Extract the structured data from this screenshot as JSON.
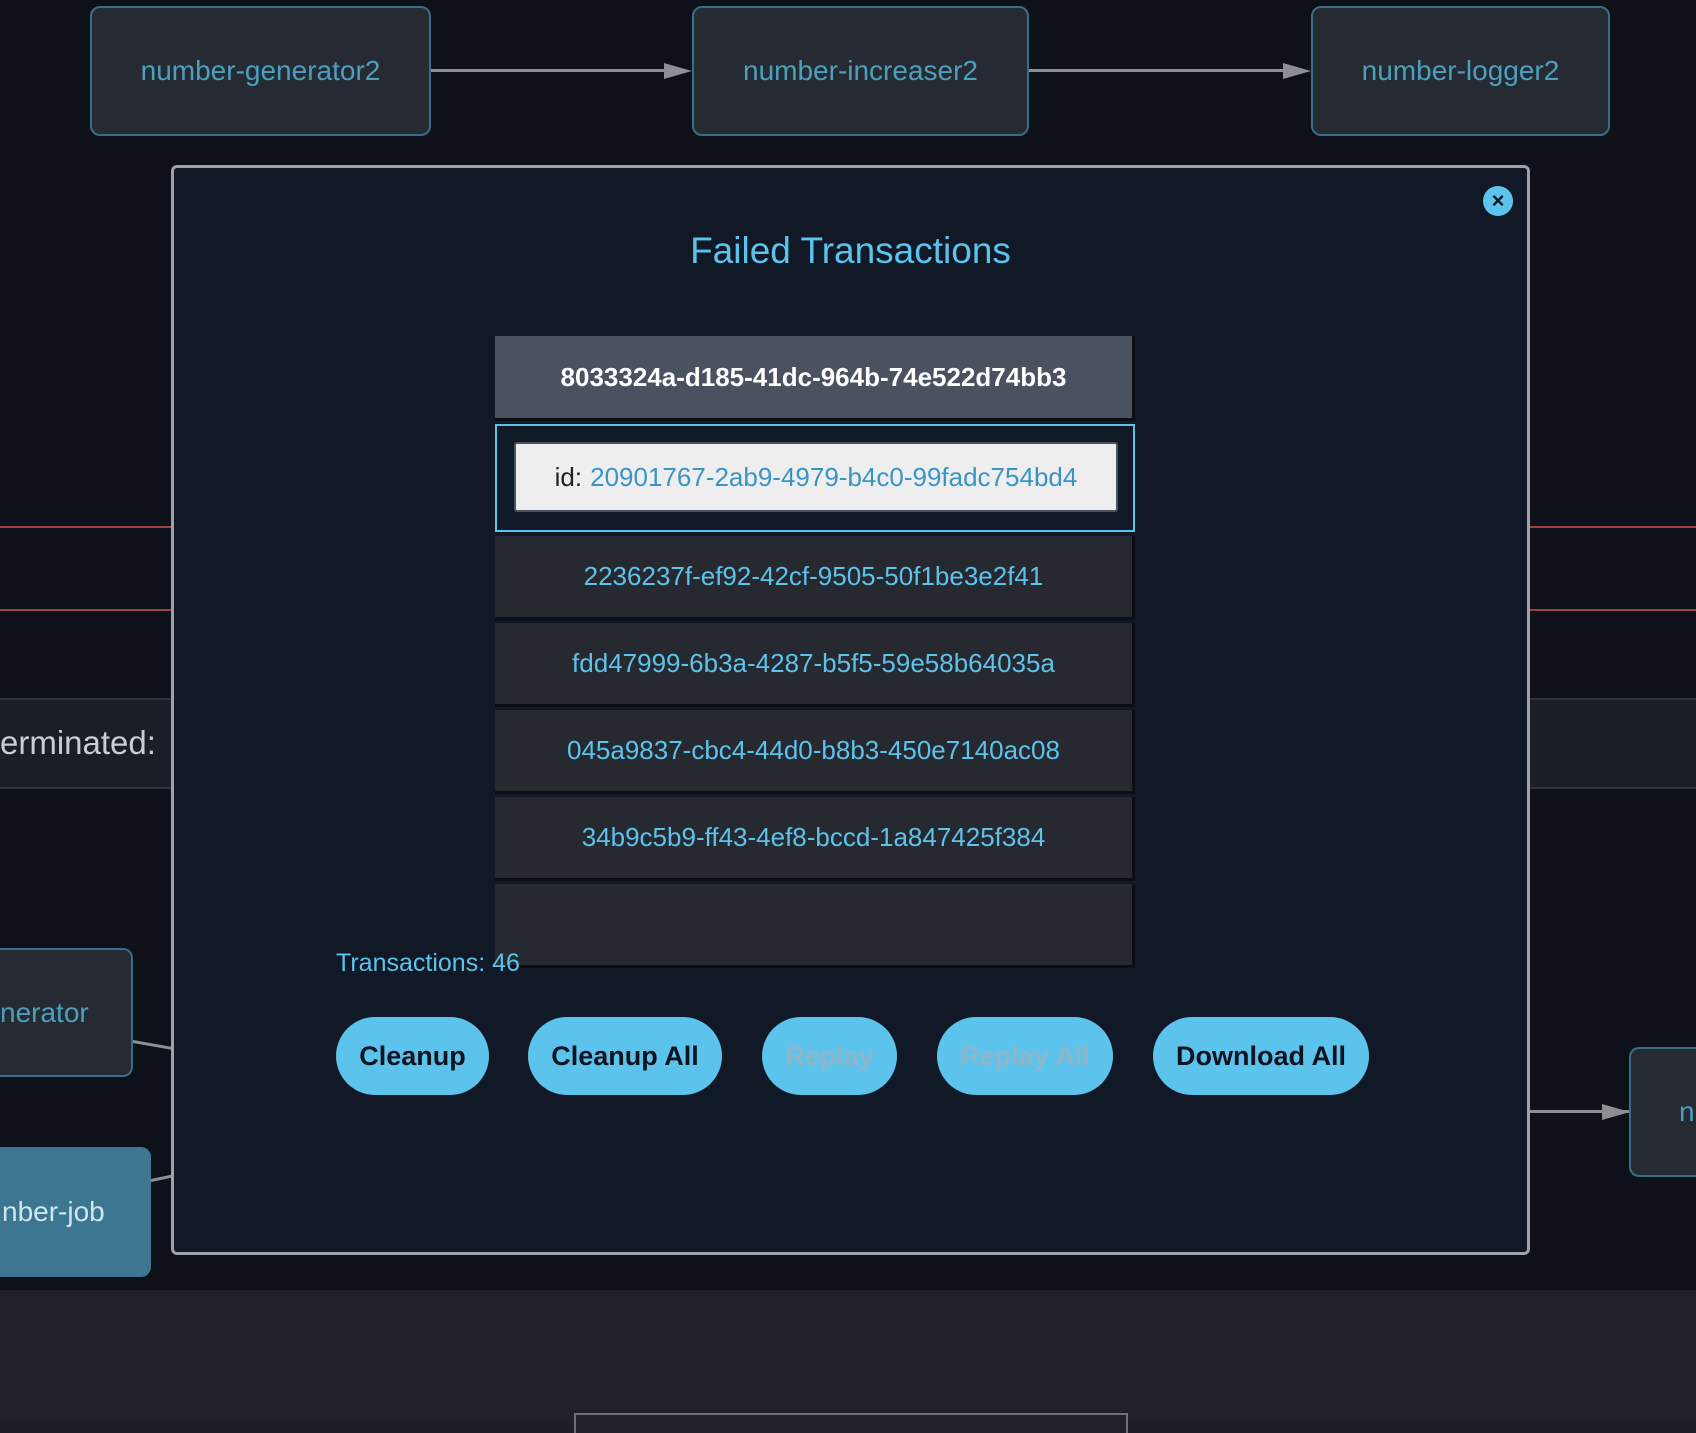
{
  "graph": {
    "top_nodes": [
      "number-generator2",
      "number-increaser2",
      "number-logger2"
    ],
    "left_band_text": "erminated:",
    "left_nodes": [
      "nerator",
      "nber-job"
    ],
    "right_node": "n"
  },
  "modal": {
    "close_icon": "×",
    "title": "Failed Transactions",
    "transactions": [
      "8033324a-d185-41dc-964b-74e522d74bb3",
      "2236237f-ef92-42cf-9505-50f1be3e2f41",
      "fdd47999-6b3a-4287-b5f5-59e58b64035a",
      "045a9837-cbc4-44d0-b8b3-450e7140ac08",
      "34b9c5b9-ff43-4ef8-bccd-1a847425f384"
    ],
    "detail": {
      "key": "id:",
      "value": "20901767-2ab9-4979-b4c0-99fadc754bd4"
    },
    "count_label": "Transactions: 46",
    "buttons": {
      "cleanup": "Cleanup",
      "cleanup_all": "Cleanup All",
      "replay": "Replay",
      "replay_all": "Replay All",
      "download_all": "Download All"
    }
  },
  "colors": {
    "accent": "#5cc3ec",
    "background": "#0e1119",
    "modal_background": "#111826",
    "selected_row": "#4a515f",
    "error_line": "#9c4240"
  }
}
